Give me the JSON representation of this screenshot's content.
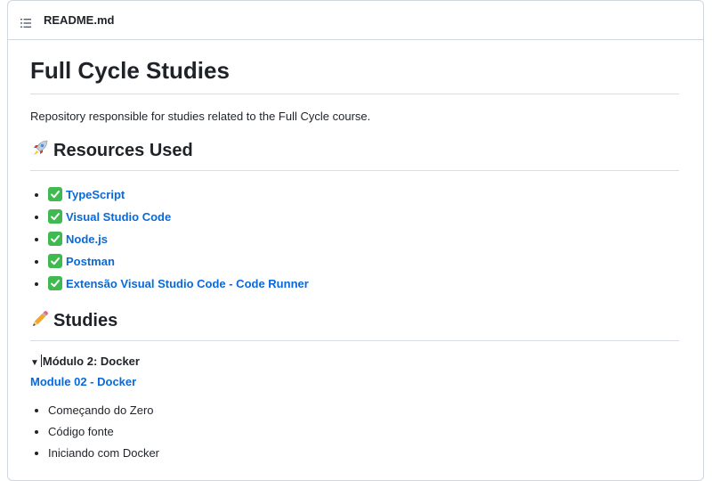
{
  "file_header": {
    "file_name": "README.md",
    "toc_icon": "list-icon"
  },
  "readme": {
    "title": "Full Cycle Studies",
    "description": "Repository responsible for studies related to the Full Cycle course.",
    "resources_section": {
      "icon": "rocket-icon",
      "heading": "Resources Used",
      "items": [
        {
          "icon": "check-mark-icon",
          "label": "TypeScript"
        },
        {
          "icon": "check-mark-icon",
          "label": "Visual Studio Code"
        },
        {
          "icon": "check-mark-icon",
          "label": "Node.js"
        },
        {
          "icon": "check-mark-icon",
          "label": "Postman"
        },
        {
          "icon": "check-mark-icon",
          "label": "Extensão Visual Studio Code - Code Runner"
        }
      ]
    },
    "studies_section": {
      "icon": "pencil-icon",
      "heading": "Studies",
      "details": {
        "summary": "Módulo 2: Docker",
        "link": "Module 02 - Docker",
        "topics": [
          "Começando do Zero",
          "Código fonte",
          "Iniciando com Docker"
        ]
      }
    }
  },
  "colors": {
    "link": "#0969da",
    "check_bg": "#3fb950",
    "border": "#d0d7de"
  }
}
